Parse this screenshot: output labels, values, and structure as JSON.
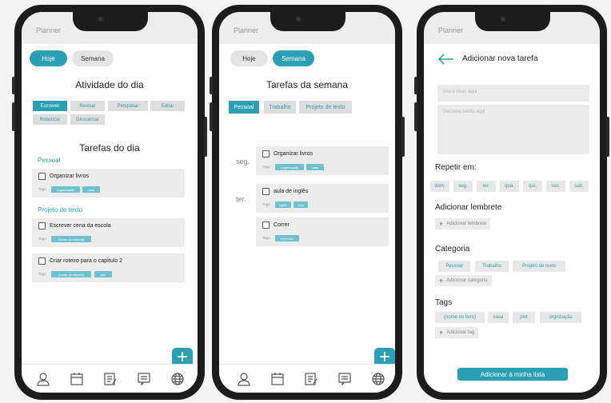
{
  "status_label": "Planner",
  "colors": {
    "accent": "#2b9fb3",
    "tag": "#6fc1cf",
    "card": "#ececec"
  },
  "screen1": {
    "toggle": {
      "today": "Hoje",
      "week": "Semana"
    },
    "activity_title": "Atividade do dia",
    "activities": [
      "Escrever",
      "Revisar",
      "Pesquisar",
      "Editar",
      "Roteirizar",
      "Descansar"
    ],
    "tasks_title": "Tarefas do dia",
    "sections": [
      {
        "name": "Pessoal",
        "tasks": [
          {
            "title": "Organizar livros",
            "tag_label": "Tags:",
            "tags": [
              "organização",
              "casa"
            ]
          }
        ]
      },
      {
        "name": "Projeto de texto",
        "tasks": [
          {
            "title": "Escrever cena da escola",
            "tag_label": "Tags:",
            "tags": [
              "(nome da historia)"
            ]
          },
          {
            "title": "Criar roteiro para o capítulo 2",
            "tag_label": "Tags:",
            "tags": [
              "(nome da historia)",
              "plot"
            ]
          }
        ]
      }
    ],
    "fab": "+"
  },
  "screen2": {
    "toggle": {
      "today": "Hoje",
      "week": "Semana"
    },
    "title": "Tarefas da semana",
    "tabs": [
      "Pessoal",
      "Trabalho",
      "Projeto de texto"
    ],
    "days": [
      {
        "label": "seg.",
        "tasks": [
          {
            "title": "Organizar livros",
            "tag_label": "Tags:",
            "tags": [
              "organização",
              "casa"
            ]
          }
        ]
      },
      {
        "label": "ter.",
        "tasks": [
          {
            "title": "aula de inglês",
            "tag_label": "Tags:",
            "tags": [
              "inglês",
              "aula"
            ]
          },
          {
            "title": "Correr",
            "tag_label": "Tags:",
            "tags": [
              "exercício"
            ]
          }
        ]
      }
    ],
    "fab": "+"
  },
  "screen3": {
    "title": "Adicionar nova tarefa",
    "title_placeholder": "Insira título aqui",
    "desc_placeholder": "Decreva tarefa aqui",
    "repeat_label": "Repetir em:",
    "days": [
      "dom.",
      "seg.",
      "ter.",
      "qua.",
      "qui.",
      "sex.",
      "sab."
    ],
    "reminder_label": "Adicionar lembrete",
    "reminder_btn": "Adicionar lembrete",
    "category_label": "Categoria",
    "categories": [
      "Pessoal",
      "Trabalho",
      "Projeto de texto"
    ],
    "category_btn": "Adicionar categoria",
    "tags_label": "Tags",
    "tags": [
      "(nome do livro)",
      "casa",
      "plot",
      "orgnização"
    ],
    "tag_btn": "Adicionar tag",
    "submit": "Adicionar à minha lista"
  },
  "nav_icons": [
    "profile-icon",
    "calendar-icon",
    "notes-icon",
    "chat-icon",
    "globe-icon"
  ]
}
